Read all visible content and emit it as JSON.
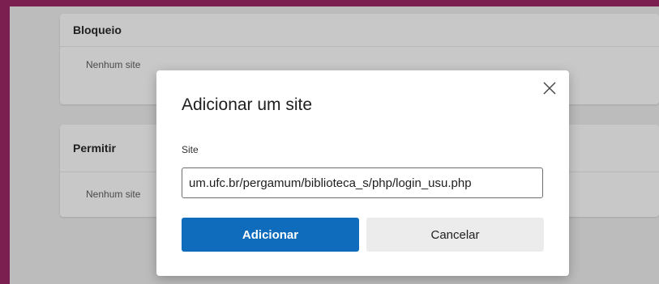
{
  "background": {
    "sections": [
      {
        "title": "Bloqueio",
        "empty_text": "Nenhum site"
      },
      {
        "title": "Permitir",
        "empty_text": "Nenhum site"
      }
    ]
  },
  "dialog": {
    "title": "Adicionar um site",
    "field_label": "Site",
    "site_value": "‎um.ufc.br/pergamum/biblioteca_s/php/login_usu.php",
    "add_label": "Adicionar",
    "cancel_label": "Cancelar",
    "close_icon": "close-icon"
  },
  "colors": {
    "primary": "#0f6cbd",
    "frame": "#7a1f4f"
  }
}
